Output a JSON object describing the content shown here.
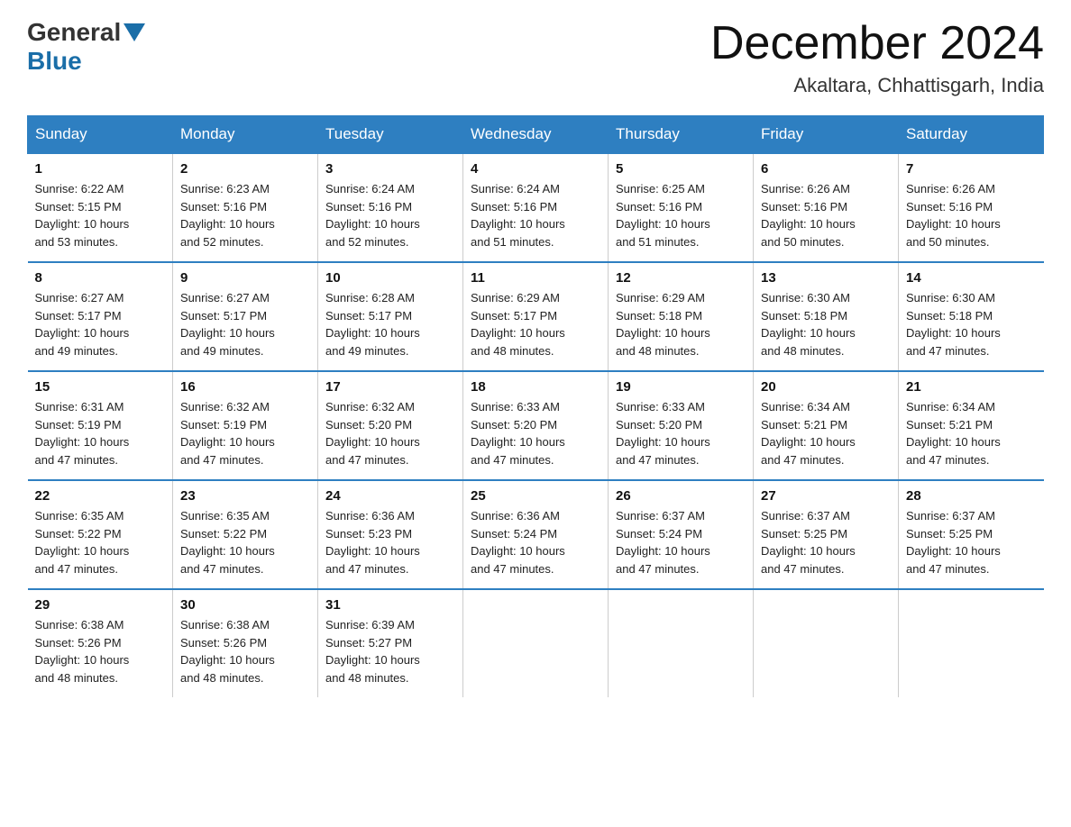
{
  "header": {
    "logo": {
      "general": "General",
      "blue": "Blue"
    },
    "title": "December 2024",
    "location": "Akaltara, Chhattisgarh, India"
  },
  "days_of_week": [
    "Sunday",
    "Monday",
    "Tuesday",
    "Wednesday",
    "Thursday",
    "Friday",
    "Saturday"
  ],
  "weeks": [
    [
      {
        "day": "1",
        "sunrise": "6:22 AM",
        "sunset": "5:15 PM",
        "daylight": "10 hours and 53 minutes."
      },
      {
        "day": "2",
        "sunrise": "6:23 AM",
        "sunset": "5:16 PM",
        "daylight": "10 hours and 52 minutes."
      },
      {
        "day": "3",
        "sunrise": "6:24 AM",
        "sunset": "5:16 PM",
        "daylight": "10 hours and 52 minutes."
      },
      {
        "day": "4",
        "sunrise": "6:24 AM",
        "sunset": "5:16 PM",
        "daylight": "10 hours and 51 minutes."
      },
      {
        "day": "5",
        "sunrise": "6:25 AM",
        "sunset": "5:16 PM",
        "daylight": "10 hours and 51 minutes."
      },
      {
        "day": "6",
        "sunrise": "6:26 AM",
        "sunset": "5:16 PM",
        "daylight": "10 hours and 50 minutes."
      },
      {
        "day": "7",
        "sunrise": "6:26 AM",
        "sunset": "5:16 PM",
        "daylight": "10 hours and 50 minutes."
      }
    ],
    [
      {
        "day": "8",
        "sunrise": "6:27 AM",
        "sunset": "5:17 PM",
        "daylight": "10 hours and 49 minutes."
      },
      {
        "day": "9",
        "sunrise": "6:27 AM",
        "sunset": "5:17 PM",
        "daylight": "10 hours and 49 minutes."
      },
      {
        "day": "10",
        "sunrise": "6:28 AM",
        "sunset": "5:17 PM",
        "daylight": "10 hours and 49 minutes."
      },
      {
        "day": "11",
        "sunrise": "6:29 AM",
        "sunset": "5:17 PM",
        "daylight": "10 hours and 48 minutes."
      },
      {
        "day": "12",
        "sunrise": "6:29 AM",
        "sunset": "5:18 PM",
        "daylight": "10 hours and 48 minutes."
      },
      {
        "day": "13",
        "sunrise": "6:30 AM",
        "sunset": "5:18 PM",
        "daylight": "10 hours and 48 minutes."
      },
      {
        "day": "14",
        "sunrise": "6:30 AM",
        "sunset": "5:18 PM",
        "daylight": "10 hours and 47 minutes."
      }
    ],
    [
      {
        "day": "15",
        "sunrise": "6:31 AM",
        "sunset": "5:19 PM",
        "daylight": "10 hours and 47 minutes."
      },
      {
        "day": "16",
        "sunrise": "6:32 AM",
        "sunset": "5:19 PM",
        "daylight": "10 hours and 47 minutes."
      },
      {
        "day": "17",
        "sunrise": "6:32 AM",
        "sunset": "5:20 PM",
        "daylight": "10 hours and 47 minutes."
      },
      {
        "day": "18",
        "sunrise": "6:33 AM",
        "sunset": "5:20 PM",
        "daylight": "10 hours and 47 minutes."
      },
      {
        "day": "19",
        "sunrise": "6:33 AM",
        "sunset": "5:20 PM",
        "daylight": "10 hours and 47 minutes."
      },
      {
        "day": "20",
        "sunrise": "6:34 AM",
        "sunset": "5:21 PM",
        "daylight": "10 hours and 47 minutes."
      },
      {
        "day": "21",
        "sunrise": "6:34 AM",
        "sunset": "5:21 PM",
        "daylight": "10 hours and 47 minutes."
      }
    ],
    [
      {
        "day": "22",
        "sunrise": "6:35 AM",
        "sunset": "5:22 PM",
        "daylight": "10 hours and 47 minutes."
      },
      {
        "day": "23",
        "sunrise": "6:35 AM",
        "sunset": "5:22 PM",
        "daylight": "10 hours and 47 minutes."
      },
      {
        "day": "24",
        "sunrise": "6:36 AM",
        "sunset": "5:23 PM",
        "daylight": "10 hours and 47 minutes."
      },
      {
        "day": "25",
        "sunrise": "6:36 AM",
        "sunset": "5:24 PM",
        "daylight": "10 hours and 47 minutes."
      },
      {
        "day": "26",
        "sunrise": "6:37 AM",
        "sunset": "5:24 PM",
        "daylight": "10 hours and 47 minutes."
      },
      {
        "day": "27",
        "sunrise": "6:37 AM",
        "sunset": "5:25 PM",
        "daylight": "10 hours and 47 minutes."
      },
      {
        "day": "28",
        "sunrise": "6:37 AM",
        "sunset": "5:25 PM",
        "daylight": "10 hours and 47 minutes."
      }
    ],
    [
      {
        "day": "29",
        "sunrise": "6:38 AM",
        "sunset": "5:26 PM",
        "daylight": "10 hours and 48 minutes."
      },
      {
        "day": "30",
        "sunrise": "6:38 AM",
        "sunset": "5:26 PM",
        "daylight": "10 hours and 48 minutes."
      },
      {
        "day": "31",
        "sunrise": "6:39 AM",
        "sunset": "5:27 PM",
        "daylight": "10 hours and 48 minutes."
      },
      null,
      null,
      null,
      null
    ]
  ],
  "labels": {
    "sunrise": "Sunrise:",
    "sunset": "Sunset:",
    "daylight": "Daylight:"
  }
}
